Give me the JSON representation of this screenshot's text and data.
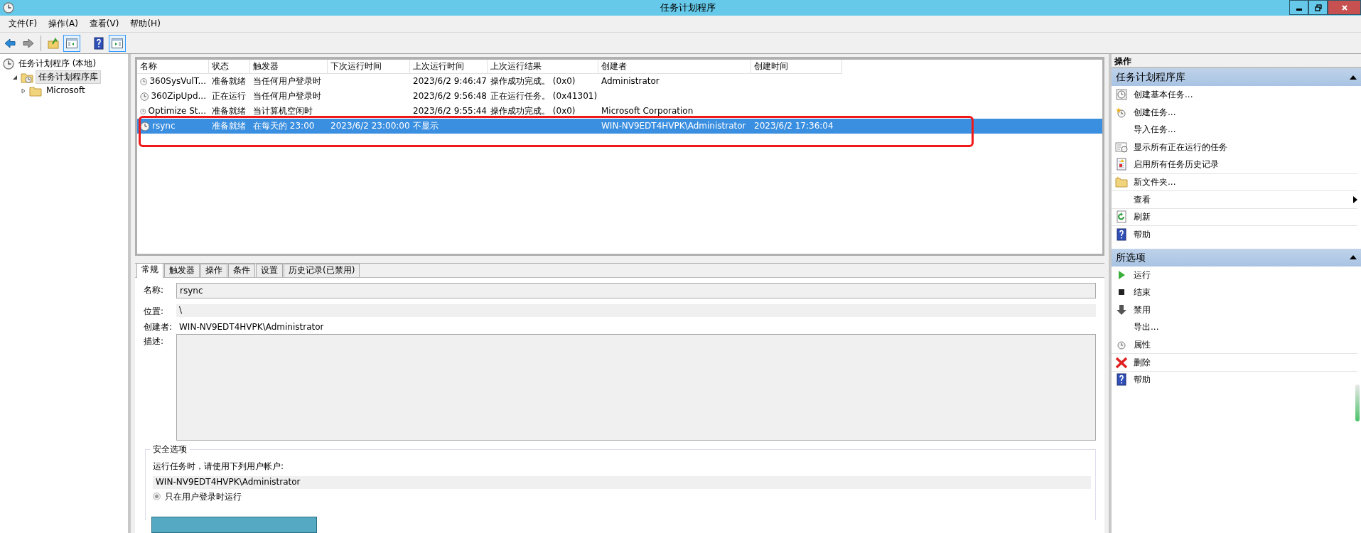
{
  "window": {
    "title": "任务计划程序"
  },
  "menu": [
    "文件(F)",
    "操作(A)",
    "查看(V)",
    "帮助(H)"
  ],
  "toolbar": [
    {
      "kind": "back",
      "pressed": false
    },
    {
      "kind": "forward",
      "pressed": false
    },
    {
      "kind": "up",
      "pressed": false
    },
    {
      "kind": "tree",
      "pressed": true
    },
    {
      "kind": "help",
      "pressed": false
    },
    {
      "kind": "actions",
      "pressed": true
    }
  ],
  "tree": [
    {
      "label": "任务计划程序 (本地)",
      "selected": false,
      "children": [
        {
          "label": "任务计划程序库",
          "selected": true,
          "expanded": true,
          "children": [
            {
              "label": "Microsoft",
              "selected": false,
              "expanded": false
            }
          ]
        }
      ]
    }
  ],
  "table": {
    "columns": [
      "名称",
      "状态",
      "触发器",
      "下次运行时间",
      "上次运行时间",
      "上次运行结果",
      "创建者",
      "创建时间"
    ],
    "rows": [
      {
        "selected": false,
        "highlighted": false,
        "cells": [
          "360SysVulT...",
          "准备就绪",
          "当任何用户登录时",
          "",
          "2023/6/2 9:46:47",
          "操作成功完成。 (0x0)",
          "Administrator",
          ""
        ]
      },
      {
        "selected": false,
        "highlighted": false,
        "cells": [
          "360ZipUpd...",
          "正在运行",
          "当任何用户登录时",
          "",
          "2023/6/2 9:56:48",
          "正在运行任务。 (0x41301)",
          "",
          ""
        ]
      },
      {
        "selected": false,
        "highlighted": false,
        "cells": [
          "Optimize St...",
          "准备就绪",
          "当计算机空闲时",
          "",
          "2023/6/2 9:55:44",
          "操作成功完成。 (0x0)",
          "Microsoft Corporation",
          ""
        ]
      },
      {
        "selected": true,
        "highlighted": true,
        "cells": [
          "rsync",
          "准备就绪",
          "在每天的 23:00",
          "2023/6/2 23:00:00",
          "不显示",
          "",
          "WIN-NV9EDT4HVPK\\Administrator",
          "2023/6/2 17:36:04"
        ]
      }
    ]
  },
  "tabs": [
    {
      "label": "常规",
      "selected": true
    },
    {
      "label": "触发器",
      "selected": false
    },
    {
      "label": "操作",
      "selected": false
    },
    {
      "label": "条件",
      "selected": false
    },
    {
      "label": "设置",
      "selected": false
    },
    {
      "label": "历史记录(已禁用)",
      "selected": false
    }
  ],
  "general": {
    "name_label": "名称:",
    "name_value": "rsync",
    "location_label": "位置:",
    "location_value": "\\",
    "author_label": "创建者:",
    "author_value": "WIN-NV9EDT4HVPK\\Administrator",
    "description_label": "描述:"
  },
  "security": {
    "legend": "安全选项",
    "prompt": "运行任务时，请使用下列用户帐户:",
    "account": "WIN-NV9EDT4HVPK\\Administrator",
    "radio": {
      "label": "只在用户登录时运行",
      "selected": true
    }
  },
  "actions": {
    "header": "操作",
    "sections": [
      {
        "title": "任务计划程序库",
        "expanded": true,
        "items": [
          {
            "label": "创建基本任务...",
            "kind": "clock-page",
            "submenu": false,
            "divider_above": false
          },
          {
            "label": "创建任务...",
            "kind": "clock-star",
            "submenu": false,
            "divider_above": false
          },
          {
            "label": "导入任务...",
            "kind": "plain",
            "submenu": false,
            "divider_above": false
          },
          {
            "label": "显示所有正在运行的任务",
            "kind": "list",
            "submenu": false,
            "divider_above": false
          },
          {
            "label": "启用所有任务历史记录",
            "kind": "log",
            "submenu": false,
            "divider_above": false
          },
          {
            "label": "新文件夹...",
            "kind": "folder",
            "submenu": false,
            "divider_above": true
          },
          {
            "label": "查看",
            "kind": "plain",
            "submenu": true,
            "divider_above": true
          },
          {
            "label": "刷新",
            "kind": "refresh",
            "submenu": false,
            "divider_above": true
          },
          {
            "label": "帮助",
            "kind": "help",
            "submenu": false,
            "divider_above": true
          }
        ]
      },
      {
        "title": "所选项",
        "expanded": true,
        "items": [
          {
            "label": "运行",
            "kind": "play",
            "submenu": false,
            "divider_above": false
          },
          {
            "label": "结束",
            "kind": "stop",
            "submenu": false,
            "divider_above": false
          },
          {
            "label": "禁用",
            "kind": "down",
            "submenu": false,
            "divider_above": false
          },
          {
            "label": "导出...",
            "kind": "plain",
            "submenu": false,
            "divider_above": false
          },
          {
            "label": "属性",
            "kind": "clock",
            "submenu": false,
            "divider_above": false
          },
          {
            "label": "删除",
            "kind": "delete",
            "submenu": false,
            "divider_above": true
          },
          {
            "label": "帮助",
            "kind": "help",
            "submenu": false,
            "divider_above": true
          }
        ]
      }
    ]
  }
}
